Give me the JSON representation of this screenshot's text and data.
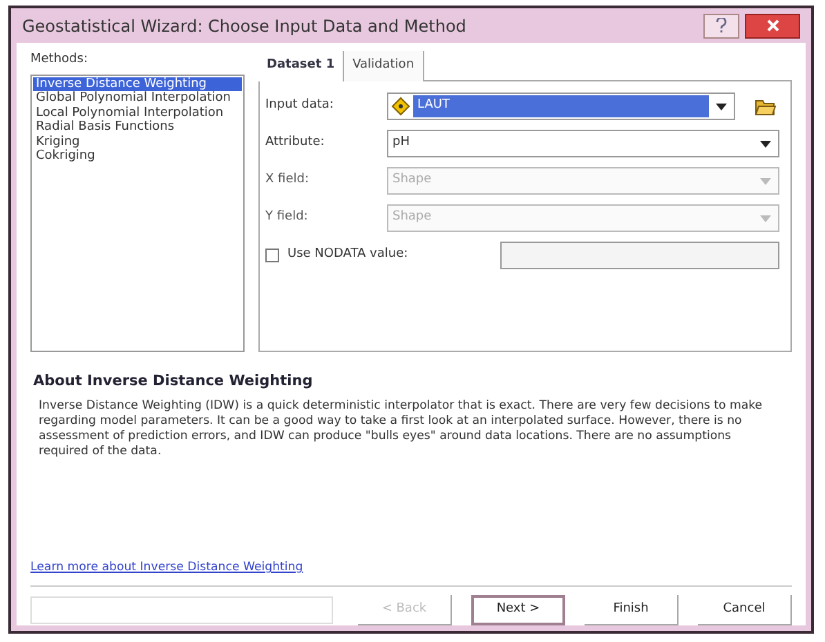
{
  "window": {
    "title": "Geostatistical Wizard: Choose Input Data and Method"
  },
  "methods": {
    "label": "Methods:",
    "items": [
      {
        "label": "Inverse Distance Weighting",
        "selected": true
      },
      {
        "label": "Global Polynomial Interpolation",
        "selected": false
      },
      {
        "label": "Local Polynomial Interpolation",
        "selected": false
      },
      {
        "label": "Radial Basis Functions",
        "selected": false
      },
      {
        "label": "Kriging",
        "selected": false
      },
      {
        "label": "Cokriging",
        "selected": false
      }
    ]
  },
  "tabs": [
    {
      "label": "Dataset 1",
      "selected": true
    },
    {
      "label": "Validation",
      "selected": false
    }
  ],
  "fields": [
    {
      "label": "Input data:",
      "value": "LAUT",
      "kind": "layer",
      "disabled": false
    },
    {
      "label": "Attribute:",
      "value": "pH",
      "kind": "dropdown",
      "disabled": false
    },
    {
      "label": "X field:",
      "value": "Shape",
      "kind": "dropdown",
      "disabled": true
    },
    {
      "label": "Y field:",
      "value": "Shape",
      "kind": "dropdown",
      "disabled": true
    }
  ],
  "nodata": {
    "label": "Use NODATA value:",
    "checked": false
  },
  "about": {
    "title": "About Inverse Distance Weighting",
    "text": "Inverse Distance Weighting (IDW) is a quick deterministic interpolator that is exact. There are very few decisions to make regarding model parameters. It can be a good way to take a first look at an interpolated surface. However, there is no assessment of prediction errors, and IDW can produce \"bulls eyes\" around data locations. There are no assumptions required of the data.",
    "link": "Learn more about Inverse Distance Weighting"
  },
  "buttons": [
    {
      "label": "< Back",
      "disabled": true,
      "default": false
    },
    {
      "label": "Next >",
      "disabled": false,
      "default": true
    },
    {
      "label": "Finish",
      "disabled": false,
      "default": false
    },
    {
      "label": "Cancel",
      "disabled": false,
      "default": false
    }
  ]
}
